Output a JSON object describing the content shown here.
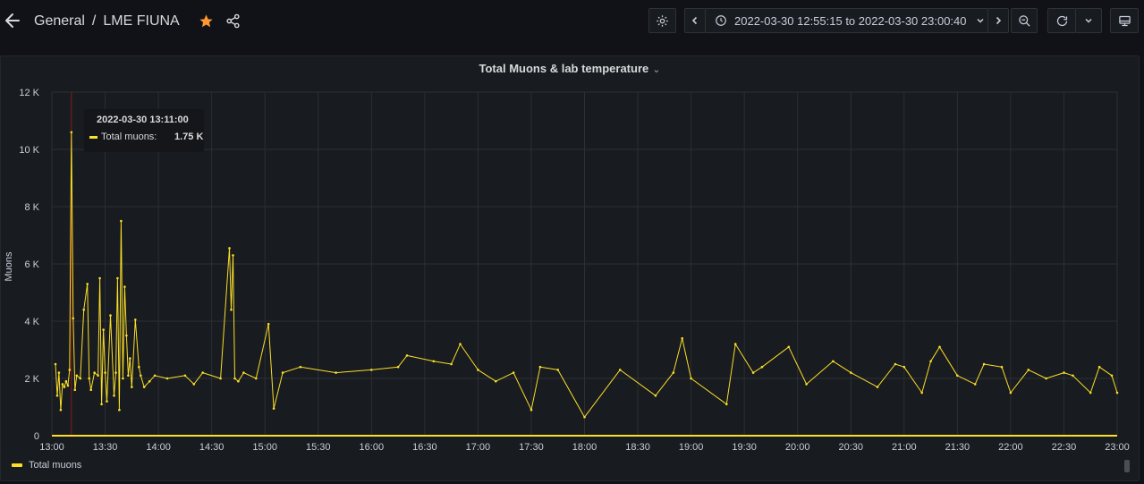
{
  "header": {
    "folder": "General",
    "separator": "/",
    "dashboard_title": "LME FIUNA",
    "time_range": "2022-03-30 12:55:15 to 2022-03-30 23:00:40"
  },
  "icons": {
    "back": "arrow-left-icon",
    "star": "star-icon",
    "share": "share-icon",
    "settings": "gear-icon",
    "time_back": "chevron-left-icon",
    "clock": "clock-icon",
    "time_forward": "chevron-right-icon",
    "zoom_out": "zoom-out-icon",
    "refresh": "refresh-icon",
    "refresh_menu": "chevron-down-icon",
    "tv_mode": "monitor-icon"
  },
  "colors": {
    "background": "#111217",
    "panel": "#181b1f",
    "series": "#fade2a",
    "star": "#ff9830",
    "cursor": "#8b1a1a",
    "grid": "#2c2f33"
  },
  "panel": {
    "title": "Total Muons & lab temperature"
  },
  "tooltip": {
    "time": "2022-03-30 13:11:00",
    "series": "Total muons:",
    "value": "1.75 K"
  },
  "chart_data": {
    "type": "line",
    "title": "Total Muons & lab temperature",
    "ylabel": "Muons",
    "xlabel": "",
    "xlim": [
      "13:00",
      "23:00"
    ],
    "ylim": [
      0,
      12000
    ],
    "y_ticks": [
      "0",
      "2 K",
      "4 K",
      "6 K",
      "8 K",
      "10 K",
      "12 K"
    ],
    "x_ticks": [
      "13:00",
      "13:30",
      "14:00",
      "14:30",
      "15:00",
      "15:30",
      "16:00",
      "16:30",
      "17:00",
      "17:30",
      "18:00",
      "18:30",
      "19:00",
      "19:30",
      "20:00",
      "20:30",
      "21:00",
      "21:30",
      "22:00",
      "22:30",
      "23:00"
    ],
    "grid": true,
    "legend_position": "bottom-left",
    "cursor_time": "13:11",
    "series": [
      {
        "name": "Total muons",
        "x": [
          "13:02",
          "13:03",
          "13:04",
          "13:05",
          "13:06",
          "13:07",
          "13:08",
          "13:09",
          "13:10",
          "13:11",
          "13:12",
          "13:13",
          "13:14",
          "13:16",
          "13:18",
          "13:20",
          "13:21",
          "13:22",
          "13:24",
          "13:26",
          "13:27",
          "13:28",
          "13:29",
          "13:30",
          "13:31",
          "13:33",
          "13:35",
          "13:36",
          "13:37",
          "13:38",
          "13:39",
          "13:40",
          "13:41",
          "13:42",
          "13:43",
          "13:44",
          "13:45",
          "13:47",
          "13:49",
          "13:50",
          "13:52",
          "13:55",
          "13:58",
          "14:05",
          "14:15",
          "14:20",
          "14:25",
          "14:35",
          "14:40",
          "14:41",
          "14:42",
          "14:43",
          "14:45",
          "14:48",
          "14:55",
          "15:02",
          "15:05",
          "15:10",
          "15:20",
          "15:40",
          "16:00",
          "16:15",
          "16:20",
          "16:35",
          "16:45",
          "16:50",
          "17:00",
          "17:10",
          "17:20",
          "17:30",
          "17:35",
          "17:45",
          "18:00",
          "18:20",
          "18:40",
          "18:50",
          "18:55",
          "19:00",
          "19:20",
          "19:25",
          "19:35",
          "19:40",
          "19:55",
          "20:05",
          "20:20",
          "20:30",
          "20:45",
          "20:55",
          "21:00",
          "21:10",
          "21:15",
          "21:20",
          "21:30",
          "21:40",
          "21:45",
          "21:55",
          "22:00",
          "22:10",
          "22:20",
          "22:30",
          "22:35",
          "22:45",
          "22:50",
          "22:57",
          "23:00"
        ],
        "values": [
          2500,
          1400,
          2200,
          900,
          1800,
          1700,
          1900,
          1750,
          2300,
          10600,
          4100,
          1600,
          2100,
          2000,
          4400,
          5300,
          2000,
          1600,
          2200,
          2100,
          5500,
          1100,
          3700,
          2200,
          1200,
          4200,
          1400,
          2200,
          5500,
          900,
          7500,
          2000,
          5200,
          3500,
          2100,
          2700,
          1700,
          4050,
          2400,
          2100,
          1700,
          1900,
          2100,
          2000,
          2100,
          1800,
          2200,
          2000,
          6550,
          4400,
          6300,
          2000,
          1900,
          2200,
          2000,
          3900,
          950,
          2200,
          2400,
          2200,
          2300,
          2400,
          2800,
          2600,
          2500,
          3200,
          2300,
          1900,
          2200,
          900,
          2400,
          2300,
          650,
          2300,
          1400,
          2200,
          3400,
          2000,
          1100,
          3200,
          2200,
          2400,
          3100,
          1800,
          2600,
          2200,
          1700,
          2500,
          2400,
          1500,
          2600,
          3100,
          2100,
          1800,
          2500,
          2400,
          1500,
          2300,
          2000,
          2200,
          2100,
          1500,
          2400,
          2100,
          1500
        ]
      }
    ]
  },
  "legend": {
    "items": [
      {
        "label": "Total muons"
      }
    ]
  }
}
